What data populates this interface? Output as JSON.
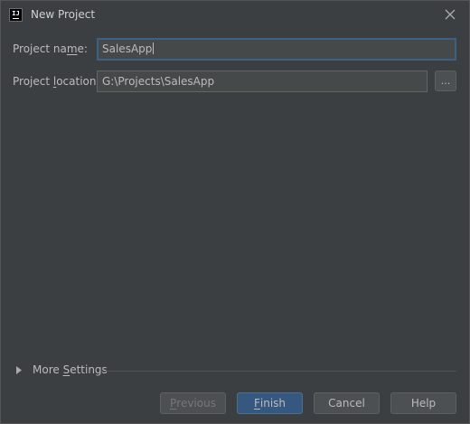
{
  "window": {
    "title": "New Project",
    "app_icon_text": "IJ"
  },
  "form": {
    "project_name": {
      "label_pre": "Project na",
      "label_mnemonic": "m",
      "label_post": "e:",
      "value": "SalesApp"
    },
    "project_location": {
      "label_pre": "Project ",
      "label_mnemonic": "l",
      "label_post": "ocation:",
      "value": "G:\\Projects\\SalesApp",
      "browse_label": "..."
    }
  },
  "more_settings": {
    "label_pre": "More ",
    "label_mnemonic": "S",
    "label_post": "ettings",
    "expanded": false
  },
  "buttons": {
    "previous": {
      "mnemonic": "P",
      "rest": "revious",
      "enabled": false
    },
    "finish": {
      "mnemonic": "F",
      "rest": "inish",
      "primary": true
    },
    "cancel": {
      "label": "Cancel"
    },
    "help": {
      "label": "Help"
    }
  },
  "colors": {
    "background": "#3c3f41",
    "input_bg": "#45494a",
    "focus_border": "#3d6185",
    "primary_button": "#365880",
    "text": "#bbbbbb"
  }
}
